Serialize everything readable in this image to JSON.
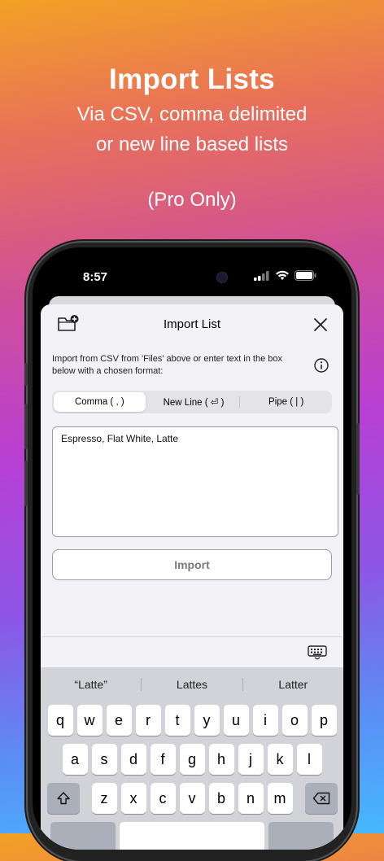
{
  "promo": {
    "title": "Import Lists",
    "subtitle_line1": "Via CSV, comma delimited",
    "subtitle_line2": "or new line based lists",
    "pro_note": "(Pro Only)"
  },
  "status_bar": {
    "time": "8:57"
  },
  "sheet": {
    "title": "Import List",
    "description": "Import from CSV from 'Files' above or enter text in the box below with a chosen format:",
    "formats": [
      {
        "label": "Comma ( , )",
        "selected": true
      },
      {
        "label": "New Line ( ⏎ )",
        "selected": false
      },
      {
        "label": "Pipe ( | )",
        "selected": false
      }
    ],
    "input_value": "Espresso, Flat White, Latte",
    "import_label": "Import"
  },
  "keyboard": {
    "suggestions": [
      "“Latte”",
      "Lattes",
      "Latter"
    ],
    "row1": [
      "q",
      "w",
      "e",
      "r",
      "t",
      "y",
      "u",
      "i",
      "o",
      "p"
    ],
    "row2": [
      "a",
      "s",
      "d",
      "f",
      "g",
      "h",
      "j",
      "k",
      "l"
    ],
    "row3": [
      "z",
      "x",
      "c",
      "v",
      "b",
      "n",
      "m"
    ],
    "shift_icon": "shift-icon",
    "delete_icon": "delete-icon"
  }
}
